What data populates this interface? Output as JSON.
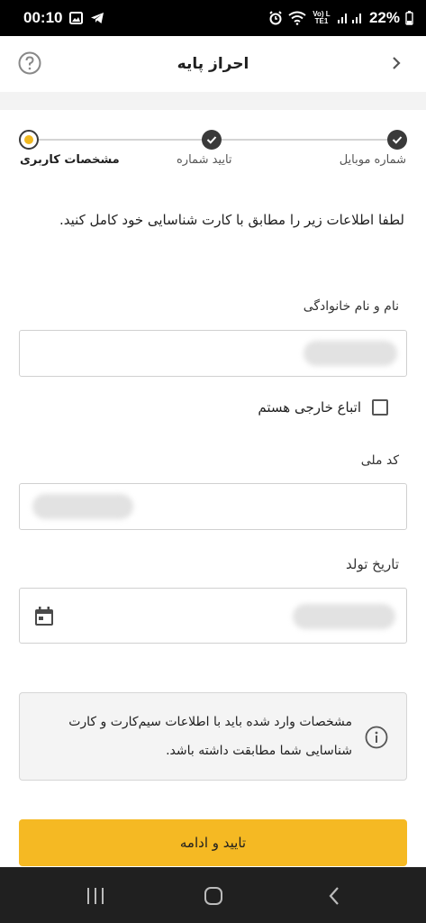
{
  "status_bar": {
    "time": "00:10",
    "battery": "22%",
    "icons": [
      "image-icon",
      "telegram-icon",
      "alarm-icon",
      "wifi-icon",
      "volte-icon",
      "signal-icon",
      "battery-icon"
    ],
    "network_label": "Vo) LTE1"
  },
  "header": {
    "title": "احراز پایه",
    "help_icon": "help-icon",
    "back_icon": "chevron-right-icon"
  },
  "stepper": {
    "steps": [
      {
        "label": "شماره موبایل",
        "state": "done"
      },
      {
        "label": "تایید شماره",
        "state": "done"
      },
      {
        "label": "مشخصات کاربری",
        "state": "current"
      }
    ]
  },
  "instructions": "لطفا اطلاعات زیر را مطابق با کارت شناسایی خود کامل کنید.",
  "form": {
    "full_name": {
      "label": "نام و نام خانوادگی",
      "value": ""
    },
    "foreign_national": {
      "label": "اتباع خارجی هستم",
      "checked": false
    },
    "national_code": {
      "label": "کد ملی",
      "value": ""
    },
    "birth_date": {
      "label": "تاریخ تولد",
      "value": "",
      "icon": "calendar-icon"
    }
  },
  "info": {
    "text": "مشخصات وارد شده باید با اطلاعات سیم‌کارت و کارت شناسایی شما مطابقت داشته باشد.",
    "icon": "info-icon"
  },
  "submit": {
    "label": "تایید و ادامه"
  },
  "colors": {
    "accent": "#f5b923",
    "step_dot": "#3a3a3a",
    "current_dot": "#f0b820"
  }
}
